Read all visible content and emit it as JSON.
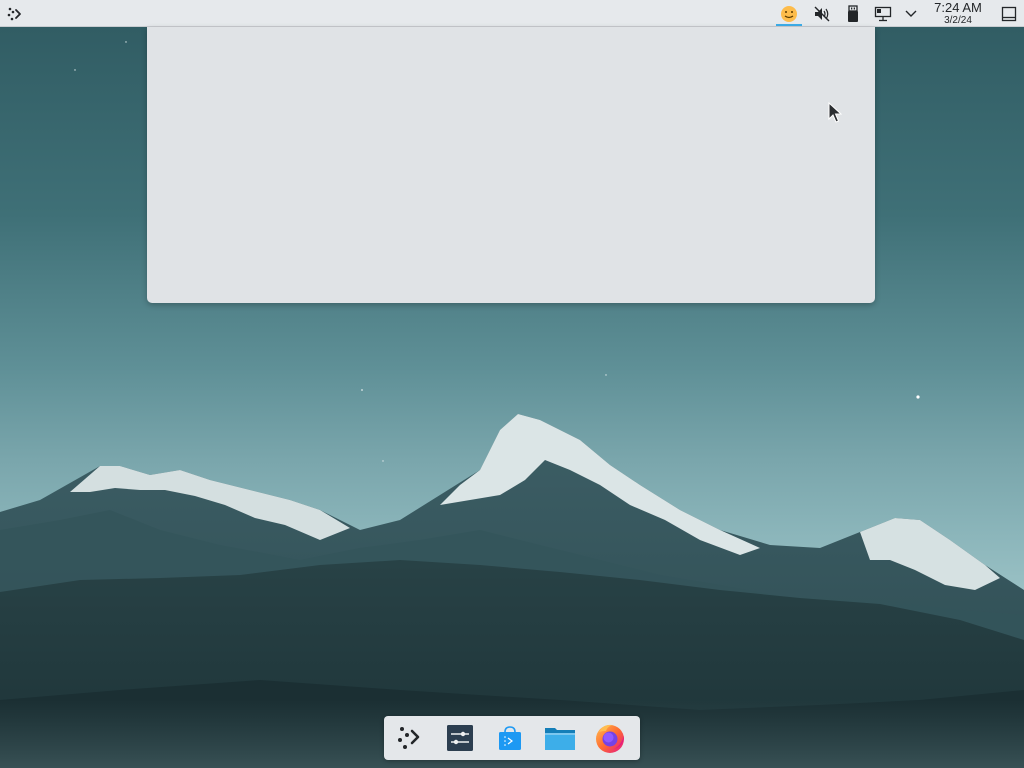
{
  "panel": {
    "launcher_icon": "kde-launcher-icon",
    "tray": [
      {
        "name": "face-smile-icon",
        "active": true
      },
      {
        "name": "speaker-muted-icon"
      },
      {
        "name": "usb-device-icon"
      },
      {
        "name": "network-wired-icon"
      },
      {
        "name": "chevron-down-icon"
      }
    ],
    "clock": {
      "time": "7:24 AM",
      "date": "3/2/24"
    },
    "show_desktop_icon": "show-desktop-icon"
  },
  "dock": {
    "items": [
      {
        "name": "application-launcher-icon"
      },
      {
        "name": "system-settings-icon"
      },
      {
        "name": "discover-store-icon"
      },
      {
        "name": "file-manager-icon"
      },
      {
        "name": "firefox-icon"
      }
    ]
  },
  "colors": {
    "panel_bg": "#e6e9ec",
    "popup_bg": "#e0e3e6",
    "accent": "#3daee9"
  }
}
